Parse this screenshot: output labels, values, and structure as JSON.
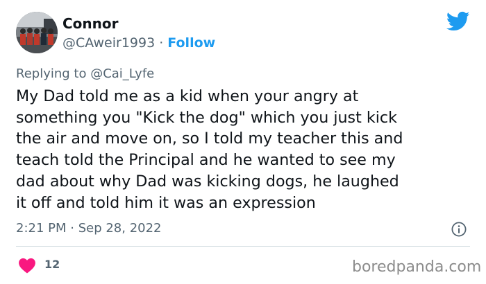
{
  "tweet": {
    "author_name": "Connor",
    "author_handle": "@CAweir1993",
    "separator": " · ",
    "follow_label": "Follow",
    "replying_prefix": "Replying to ",
    "replying_to": "@Cai_Lyfe",
    "text": "My Dad told me as a kid when your angry at\nsomething you \"Kick the dog\" which you just kick\nthe air and move on, so I told my teacher this and\nteach told the Principal and he wanted to see my\ndad about why Dad was kicking dogs, he laughed\nit off and told him it was an expression",
    "time": "2:21 PM",
    "date": "Sep 28, 2022",
    "like_count": "12"
  },
  "icons": {
    "platform": "twitter-bird-icon",
    "info": "info-icon",
    "like": "heart-icon"
  },
  "colors": {
    "accent": "#1d9bf0",
    "like": "#f91880",
    "secondary_text": "#536471"
  },
  "watermark": "boredpanda.com"
}
